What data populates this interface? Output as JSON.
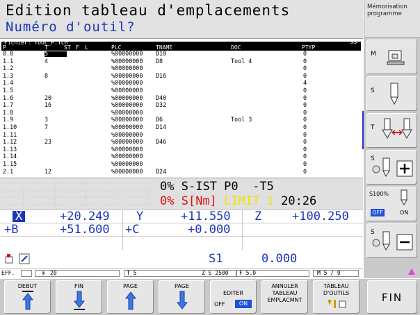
{
  "header": {
    "title": "Edition tableau d'emplacements",
    "subtitle": "Numéro d'outil?"
  },
  "mode": {
    "label": "Mémorisation programme"
  },
  "table": {
    "file_label": "Fichier: TOOL_P.TCH",
    "scroll_indicator": ">>",
    "columns": [
      "P",
      "T",
      "ST",
      "F",
      "L",
      "PLC",
      "TNAME",
      "DOC",
      "PTYP"
    ],
    "rows": [
      {
        "p": "0.0",
        "t": "5",
        "plc": "%00000000",
        "tname": "D10",
        "doc": "",
        "ptyp": "0",
        "cursor": true
      },
      {
        "p": "1.1",
        "t": "4",
        "plc": "%00000000",
        "tname": "D8",
        "doc": "Tool 4",
        "ptyp": "0"
      },
      {
        "p": "1.2",
        "t": "",
        "plc": "%00000000",
        "tname": "",
        "doc": "",
        "ptyp": "0"
      },
      {
        "p": "1.3",
        "t": "8",
        "plc": "%00000000",
        "tname": "D16",
        "doc": "",
        "ptyp": "0"
      },
      {
        "p": "1.4",
        "t": "",
        "plc": "%00000000",
        "tname": "",
        "doc": "",
        "ptyp": "4"
      },
      {
        "p": "1.5",
        "t": "",
        "plc": "%00000000",
        "tname": "",
        "doc": "",
        "ptyp": "0"
      },
      {
        "p": "1.6",
        "t": "20",
        "plc": "%00000000",
        "tname": "D40",
        "doc": "",
        "ptyp": "0"
      },
      {
        "p": "1.7",
        "t": "16",
        "plc": "%00000000",
        "tname": "D32",
        "doc": "",
        "ptyp": "0"
      },
      {
        "p": "1.8",
        "t": "",
        "plc": "%00000000",
        "tname": "",
        "doc": "",
        "ptyp": "0"
      },
      {
        "p": "1.9",
        "t": "3",
        "plc": "%00000000",
        "tname": "D6",
        "doc": "Tool 3",
        "ptyp": "0"
      },
      {
        "p": "1.10",
        "t": "7",
        "plc": "%00000000",
        "tname": "D14",
        "doc": "",
        "ptyp": "0"
      },
      {
        "p": "1.11",
        "t": "",
        "plc": "%00000000",
        "tname": "",
        "doc": "",
        "ptyp": "0"
      },
      {
        "p": "1.12",
        "t": "23",
        "plc": "%00000000",
        "tname": "D46",
        "doc": "",
        "ptyp": "0"
      },
      {
        "p": "1.13",
        "t": "",
        "plc": "%00000000",
        "tname": "",
        "doc": "",
        "ptyp": "0"
      },
      {
        "p": "1.14",
        "t": "",
        "plc": "%00000000",
        "tname": "",
        "doc": "",
        "ptyp": "0"
      },
      {
        "p": "1.15",
        "t": "",
        "plc": "%00000000",
        "tname": "",
        "doc": "",
        "ptyp": "0"
      },
      {
        "p": "2.1",
        "t": "12",
        "plc": "%00000000",
        "tname": "D24",
        "doc": "",
        "ptyp": "0"
      }
    ]
  },
  "status": {
    "spindle_load_pct": "0%",
    "spindle_label": "S-IST",
    "program_label": "P0",
    "tool_label": "-T5",
    "torque_pct": "0%",
    "torque_label": "S[Nm]",
    "limit_label": "LIMIT",
    "limit_value": "1",
    "time": "20:26"
  },
  "positions": {
    "x_label": "X",
    "x_value": "+20.249",
    "y_label": "Y",
    "y_value": "+11.550",
    "z_label": "Z",
    "z_value": "+100.250",
    "b_label": "+B",
    "b_value": "+51.600",
    "c_label": "+C",
    "c_value": "+0.000",
    "s1_label": "S1",
    "s1_value": "0.000"
  },
  "effbar": {
    "eff": "EFF.",
    "feed": "20",
    "tool": "T 5",
    "zs": "Z S 2500",
    "f": "F 5.0",
    "m": "M 5 / 9"
  },
  "sidebar": {
    "m_label": "M",
    "s_label": "S",
    "t_label": "T",
    "s2_label": "S",
    "override_label": "S100%",
    "off": "OFF",
    "on": "ON",
    "s3_label": "S"
  },
  "softkeys": {
    "debut": "DEBUT",
    "fin": "FIN",
    "page_up": "PAGE",
    "page_down": "PAGE",
    "editer": "EDITER",
    "editer_off": "OFF",
    "editer_on": "ON",
    "annuler_1": "ANNULER",
    "annuler_2": "TABLEAU",
    "annuler_3": "EMPLACMNT",
    "tableau_1": "TABLEAU",
    "tableau_2": "D'OUTILS",
    "fin_main": "FIN"
  },
  "colors": {
    "accent_blue": "#1b37b6",
    "alert_red": "#e01010",
    "limit_yellow": "#e8e800",
    "on_blue": "#2050d8"
  }
}
